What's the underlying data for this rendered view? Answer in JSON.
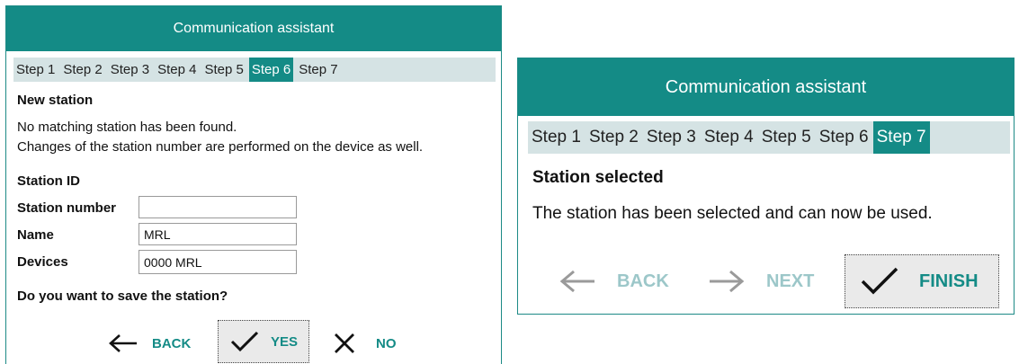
{
  "dialog_left": {
    "title": "Communication assistant",
    "steps": [
      "Step 1",
      "Step 2",
      "Step 3",
      "Step 4",
      "Step 5",
      "Step 6",
      "Step 7"
    ],
    "active_step": "Step 6",
    "heading": "New station",
    "message_line1": "No matching station has been found.",
    "message_line2": "Changes of the station number are performed on the device as well.",
    "station_id_label": "Station ID",
    "fields": {
      "station_number": {
        "label": "Station number",
        "value": ""
      },
      "name": {
        "label": "Name",
        "value": "MRL"
      },
      "devices": {
        "label": "Devices",
        "value": "0000 MRL"
      }
    },
    "question": "Do you want to save the station?",
    "buttons": {
      "back": "BACK",
      "yes": "YES",
      "no": "NO"
    }
  },
  "dialog_right": {
    "title": "Communication assistant",
    "steps": [
      "Step 1",
      "Step 2",
      "Step 3",
      "Step 4",
      "Step 5",
      "Step 6",
      "Step 7"
    ],
    "active_step": "Step 7",
    "heading": "Station selected",
    "message": "The station has been selected and can now be used.",
    "buttons": {
      "back": "BACK",
      "next": "NEXT",
      "finish": "FINISH"
    }
  },
  "colors": {
    "accent": "#148b86",
    "step_bar": "#d5e3e4",
    "disabled": "#9cc7c9"
  },
  "icons": [
    "arrow-left-icon",
    "check-icon",
    "close-icon",
    "arrow-right-icon"
  ]
}
